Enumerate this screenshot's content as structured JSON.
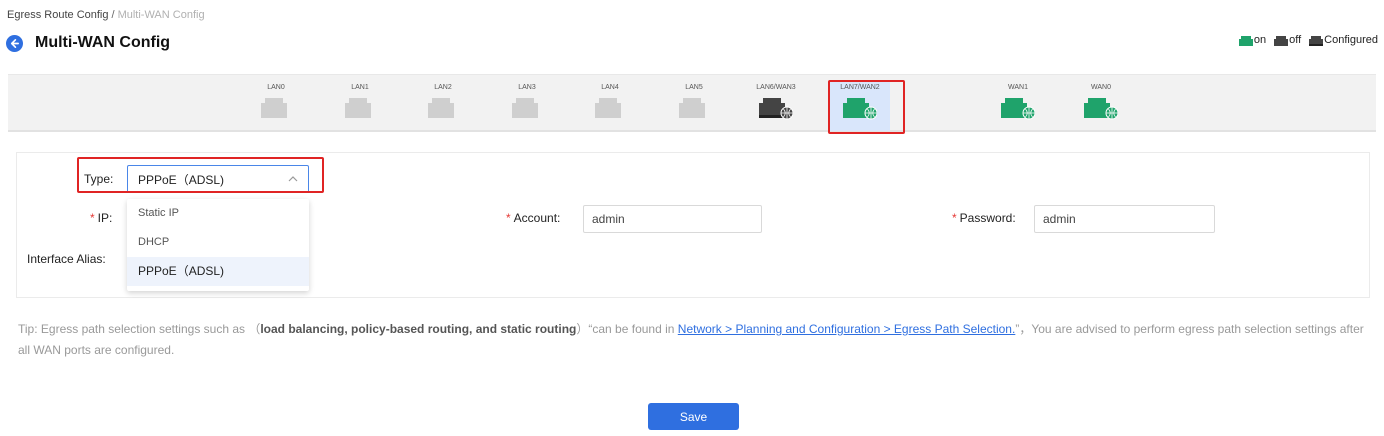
{
  "breadcrumb": {
    "parent": "Egress Route Config",
    "separator": "/",
    "current": "Multi-WAN Config"
  },
  "page": {
    "title": "Multi-WAN Config"
  },
  "legend": [
    {
      "label": "on",
      "color": "#1fa36b",
      "icon": "port-on-icon"
    },
    {
      "label": "off",
      "color": "#444444",
      "icon": "port-off-icon"
    },
    {
      "label": "Configured",
      "color": "#444444",
      "icon": "port-configured-icon"
    }
  ],
  "ports": [
    {
      "label": "LAN0",
      "state": "idle"
    },
    {
      "label": "LAN1",
      "state": "idle"
    },
    {
      "label": "LAN2",
      "state": "idle"
    },
    {
      "label": "LAN3",
      "state": "idle"
    },
    {
      "label": "LAN4",
      "state": "idle"
    },
    {
      "label": "LAN5",
      "state": "idle"
    },
    {
      "label": "LAN6/WAN3",
      "state": "off-wan"
    },
    {
      "label": "LAN7/WAN2",
      "state": "on-wan",
      "selected": true
    },
    {
      "label": "WAN1",
      "state": "on-wan"
    },
    {
      "label": "WAN0",
      "state": "on-wan"
    }
  ],
  "form": {
    "type_label": "Type:",
    "type_value": "PPPoE（ADSL)",
    "ip_label": "IP:",
    "account_label": "Account:",
    "account_value": "admin",
    "password_label": "Password:",
    "password_value": "admin",
    "alias_label": "Interface Alias:",
    "type_options": [
      "Static IP",
      "DHCP",
      "PPPoE（ADSL)"
    ],
    "selected_option": "PPPoE（ADSL)"
  },
  "tip": {
    "prefix": "Tip: Egress path selection settings such as （",
    "bold": "load balancing, policy-based routing, and static routing",
    "middle": "）“can be found in ",
    "link": "Network > Planning and Configuration > Egress Path Selection.",
    "suffix": "”，You are advised to perform egress path selection settings after all WAN ports are configured."
  },
  "actions": {
    "save_label": "Save"
  },
  "colors": {
    "accent": "#2f6fe0",
    "port_on": "#1fa36b",
    "port_off": "#444444",
    "port_idle": "#cfcfcf",
    "highlight_box": "#e02424"
  }
}
